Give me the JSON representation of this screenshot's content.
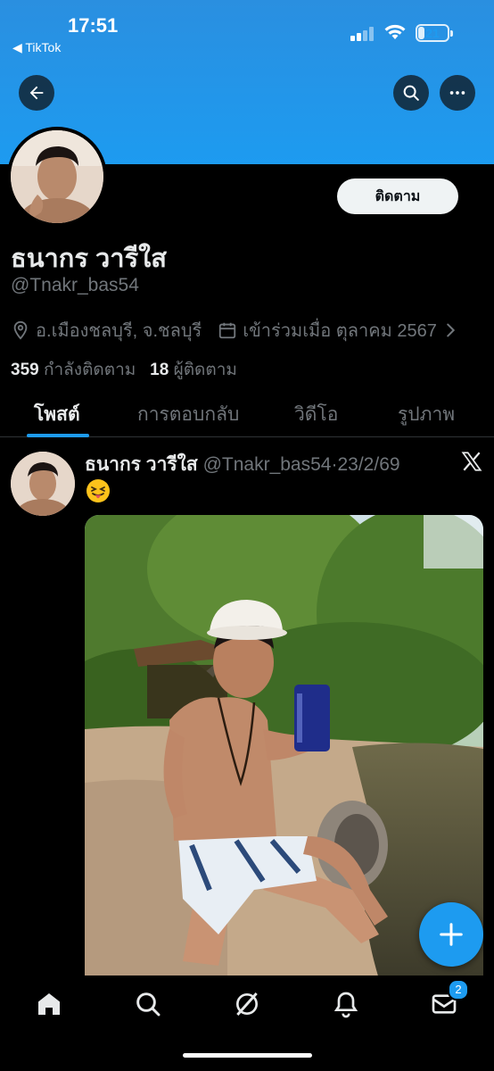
{
  "status_bar": {
    "time": "17:51",
    "back_app": "◀ TikTok",
    "battery": "21",
    "battery_level": 0.21
  },
  "profile": {
    "display_name": "ธนากร วารีใส",
    "handle": "@Tnakr_bas54",
    "location": "อ.เมืองชลบุรี, จ.ชลบุรี",
    "joined": "เข้าร่วมเมื่อ ตุลาคม 2567",
    "following_count": "359",
    "following_label": "กำลังติดตาม",
    "followers_count": "18",
    "followers_label": "ผู้ติดตาม",
    "follow_button": "ติดตาม"
  },
  "tabs": [
    {
      "label": "โพสต์",
      "active": true
    },
    {
      "label": "การตอบกลับ",
      "active": false
    },
    {
      "label": "วิดีโอ",
      "active": false
    },
    {
      "label": "รูปภาพ",
      "active": false
    }
  ],
  "post": {
    "name": "ธนากร วารีใส",
    "handle": "@Tnakr_bas54",
    "separator": "·",
    "date": "23/2/69",
    "emoji": "😝"
  },
  "bottom_nav": {
    "items": [
      "home-icon",
      "search-icon",
      "grok-icon",
      "notifications-icon",
      "messages-icon"
    ],
    "messages_badge": "2"
  },
  "colors": {
    "accent": "#1d9bf0",
    "background": "#000000",
    "secondary_text": "#71767b"
  }
}
